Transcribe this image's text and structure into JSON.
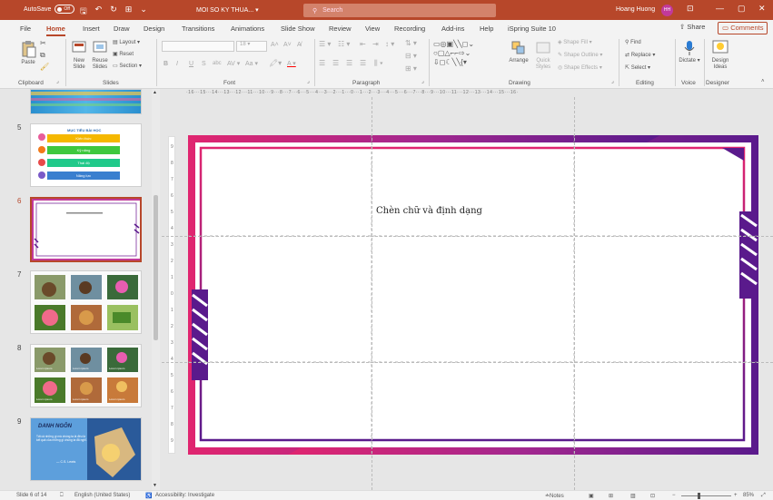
{
  "titlebar": {
    "autosave_label": "AutoSave",
    "autosave_state": "Off",
    "doc_title": "MOI SO KY THUA...",
    "search_placeholder": "Search",
    "user_name": "Hoang Huong",
    "user_initials": "HH",
    "minimize_glyph": "—",
    "restore_glyph": "▢",
    "close_glyph": "✕",
    "display_glyph": "⊡"
  },
  "ribbon_tabs": [
    "File",
    "Home",
    "Insert",
    "Draw",
    "Design",
    "Transitions",
    "Animations",
    "Slide Show",
    "Review",
    "View",
    "Recording",
    "Add-ins",
    "Help",
    "iSpring Suite 10"
  ],
  "ribbon_actions": {
    "share": "Share",
    "comments": "Comments"
  },
  "ribbon_groups": {
    "clipboard": {
      "label": "Clipboard",
      "paste": "Paste"
    },
    "slides": {
      "label": "Slides",
      "new_slide": "New Slide",
      "reuse_slides": "Reuse Slides",
      "layout": "Layout",
      "reset": "Reset",
      "section": "Section"
    },
    "font": {
      "label": "Font",
      "font_size": "18"
    },
    "paragraph": {
      "label": "Paragraph"
    },
    "drawing": {
      "label": "Drawing",
      "arrange": "Arrange",
      "quick_styles": "Quick Styles",
      "shape_fill": "Shape Fill",
      "shape_outline": "Shape Outline",
      "shape_effects": "Shape Effects"
    },
    "editing": {
      "label": "Editing",
      "find": "Find",
      "replace": "Replace",
      "select": "Select"
    },
    "voice": {
      "label": "Voice",
      "dictate": "Dictate"
    },
    "designer": {
      "label": "Designer",
      "design_ideas": "Design Ideas"
    }
  },
  "slides_panel": {
    "slide5": {
      "number": "5",
      "title": "MỤC TIÊU BÀI HỌC",
      "items": [
        "Kiến thức",
        "Kỹ năng",
        "Thái độ",
        "Năng lực"
      ]
    },
    "slide6": {
      "number": "6"
    },
    "slide7": {
      "number": "7"
    },
    "slide8": {
      "number": "8",
      "captions": [
        "Lorem ipsum",
        "Lorem ipsum",
        "Lorem ipsum",
        "Lorem ipsum",
        "Lorem ipsum",
        "Lorem ipsum"
      ]
    },
    "slide9": {
      "number": "9",
      "title": "DANH NGÔN",
      "quote": "Tất cả những gì mà chúng ta là đều là kết quả của những gì chúng ta đã nghĩ.",
      "author": "— C.S. Lewis"
    }
  },
  "slide": {
    "text": "Chèn chữ và định dạng"
  },
  "ruler_h": "·16···15···14···13···12···11···10···9···8···7···6···5···4···3···2···1···0···1···2···3···4···5···6···7···8···9···10···11···12···13···14···15···16·",
  "ruler_v": [
    "9",
    "8",
    "7",
    "6",
    "5",
    "4",
    "3",
    "2",
    "1",
    "0",
    "1",
    "2",
    "3",
    "4",
    "5",
    "6",
    "7",
    "8",
    "9"
  ],
  "statusbar": {
    "slide_count": "Slide 6 of 14",
    "language": "English (United States)",
    "accessibility": "Accessibility: Investigate",
    "notes": "Notes",
    "zoom": "85%"
  },
  "colors": {
    "accent": "#b7472a",
    "frame_pink": "#e0256f",
    "frame_purple": "#5a1a8c"
  }
}
